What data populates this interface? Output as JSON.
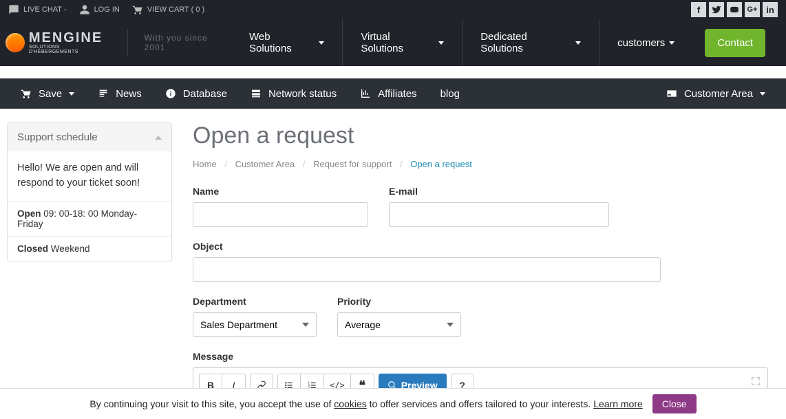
{
  "topbar": {
    "live_chat": "LIVE CHAT -",
    "login": "LOG IN",
    "cart": "VIEW CART ( 0 )"
  },
  "brand": {
    "name_a": "men",
    "name_b": "GINE",
    "sub": "SOLUTIONS D'HÉBERGEMENTS",
    "tagline": "With you since 2001"
  },
  "nav": {
    "web": "Web Solutions",
    "virtual": "Virtual Solutions",
    "dedicated": "Dedicated Solutions",
    "customers": "customers",
    "contact": "Contact"
  },
  "secbar": {
    "save": "Save",
    "news": "News",
    "database": "Database",
    "network": "Network status",
    "affiliates": "Affiliates",
    "blog": "blog",
    "customer_area": "Customer Area"
  },
  "sidebar": {
    "title": "Support schedule",
    "greeting": "Hello! We are open and will respond to your ticket soon!",
    "open_label": "Open",
    "open_hours": "09: 00-18: 00 Monday-Friday",
    "closed_label": "Closed",
    "closed_hours": "Weekend"
  },
  "page": {
    "title": "Open a request",
    "crumbs": {
      "home": "Home",
      "area": "Customer Area",
      "support": "Request for support",
      "current": "Open a request"
    }
  },
  "form": {
    "name": "Name",
    "email": "E-mail",
    "object": "Object",
    "department": "Department",
    "department_value": "Sales Department",
    "priority": "Priority",
    "priority_value": "Average",
    "message": "Message",
    "preview": "Preview"
  },
  "cookie": {
    "t1": "By continuing your visit to this site, you accept the use of ",
    "t2": "cookies",
    "t3": " to offer services and offers tailored to your interests. ",
    "t4": "Learn more ",
    "close": "Close"
  }
}
